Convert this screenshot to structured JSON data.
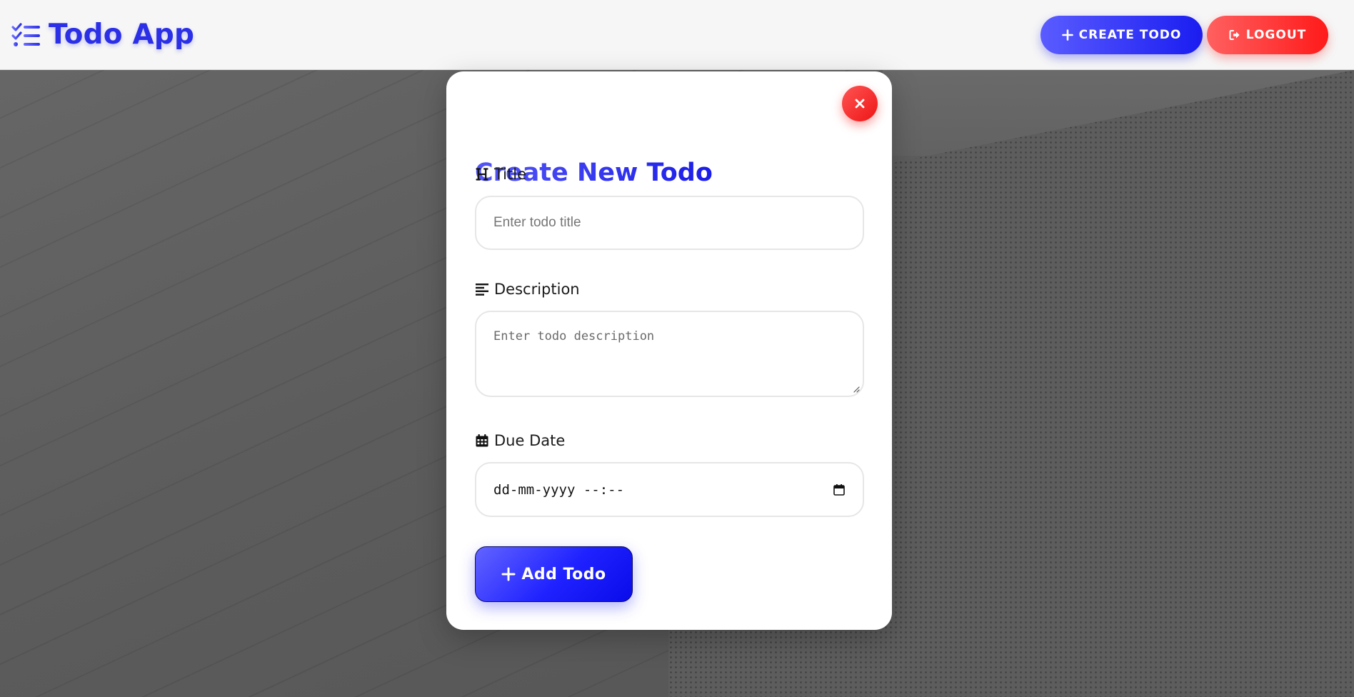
{
  "header": {
    "brand_icon": "list-check-icon",
    "app_title": "Todo App",
    "create_label": "CREATE TODO",
    "create_icon": "plus-icon",
    "logout_label": "LOGOUT",
    "logout_icon": "sign-out-icon"
  },
  "modal": {
    "title": "Create New Todo",
    "close_icon": "close-icon",
    "fields": {
      "title": {
        "icon": "heading-icon",
        "label": "Title",
        "placeholder": "Enter todo title",
        "value": ""
      },
      "description": {
        "icon": "align-left-icon",
        "label": "Description",
        "placeholder": "Enter todo description",
        "value": ""
      },
      "due_date": {
        "icon": "calendar-icon",
        "label": "Due Date",
        "placeholder": "dd-mm-yyyy --:--",
        "value": ""
      }
    },
    "submit_label": "Add Todo",
    "submit_icon": "plus-icon"
  },
  "colors": {
    "brand": "#2b2fe6",
    "primary_gradient_start": "#5a5cff",
    "primary_gradient_end": "#0a0bea",
    "danger_gradient_start": "#ff6060",
    "danger_gradient_end": "#ff1a1a",
    "header_bg": "#f6f6f6",
    "overlay_bg": "#5a5a5a"
  }
}
